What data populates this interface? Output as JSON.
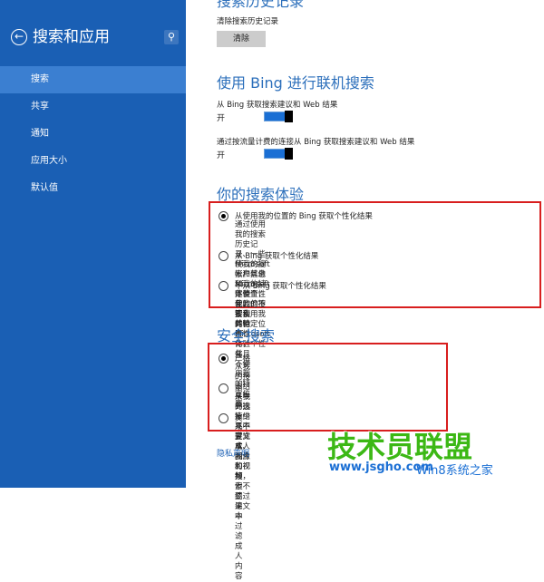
{
  "sidebar": {
    "title": "搜索和应用",
    "items": [
      {
        "label": "搜索",
        "active": true
      },
      {
        "label": "共享",
        "active": false
      },
      {
        "label": "通知",
        "active": false
      },
      {
        "label": "应用大小",
        "active": false
      },
      {
        "label": "默认值",
        "active": false
      }
    ]
  },
  "history": {
    "section_title": "搜索历史记录",
    "clear_label": "清除搜索历史记录",
    "clear_button": "清除"
  },
  "bing": {
    "section_title": "使用 Bing 进行联机搜索",
    "option1_label": "从 Bing 获取搜索建议和 Web 结果",
    "option1_state": "开",
    "option2_label": "通过按流量计费的连接从 Bing 获取搜索建议和 Web 结果",
    "option2_state": "开"
  },
  "experience": {
    "section_title": "你的搜索体验",
    "options": [
      {
        "title": "从使用我的位置的 Bing 获取个性化结果",
        "desc1": "通过使用我的搜索历史记录、一些 Microsoft 帐户信息和我的特定位置，使我的搜索和",
        "desc2": "其他 Microsoft 体验个性化",
        "checked": true
      },
      {
        "title": "从 Bing 获取个性化结果",
        "desc1": "使我的搜索和其他 Microsoft 体验个性化，但不要使用我的特定位置",
        "desc2": "",
        "checked": false
      },
      {
        "title": "不从 Bing 获取个性化结果",
        "desc1": "不使我的搜索体验个性化，并且不使用我的特定位置",
        "desc2": "",
        "checked": false
      }
    ]
  },
  "safe_search": {
    "section_title": "安全搜索",
    "options": [
      {
        "title": "严格",
        "desc": "从我的搜索结果中筛选掉少儿不宜文本、图像和视频",
        "checked": true
      },
      {
        "title": "中",
        "desc": "从我的搜索结果中过滤成人图片和视频，但不要过滤文本",
        "checked": false
      },
      {
        "title": "关",
        "desc": "不要从我的搜索结果中过滤成人内容",
        "checked": false
      }
    ]
  },
  "privacy_link": "隐私声明",
  "watermark": {
    "logo": "技术员联盟",
    "domain": "www.jsgho.com",
    "tail": "Win8系统之家"
  },
  "colors": {
    "sidebar_bg": "#1a5fb4",
    "active_item": "#3b7fd1",
    "accent_title": "#2c6fbb",
    "highlight_box": "#d81e1e"
  }
}
